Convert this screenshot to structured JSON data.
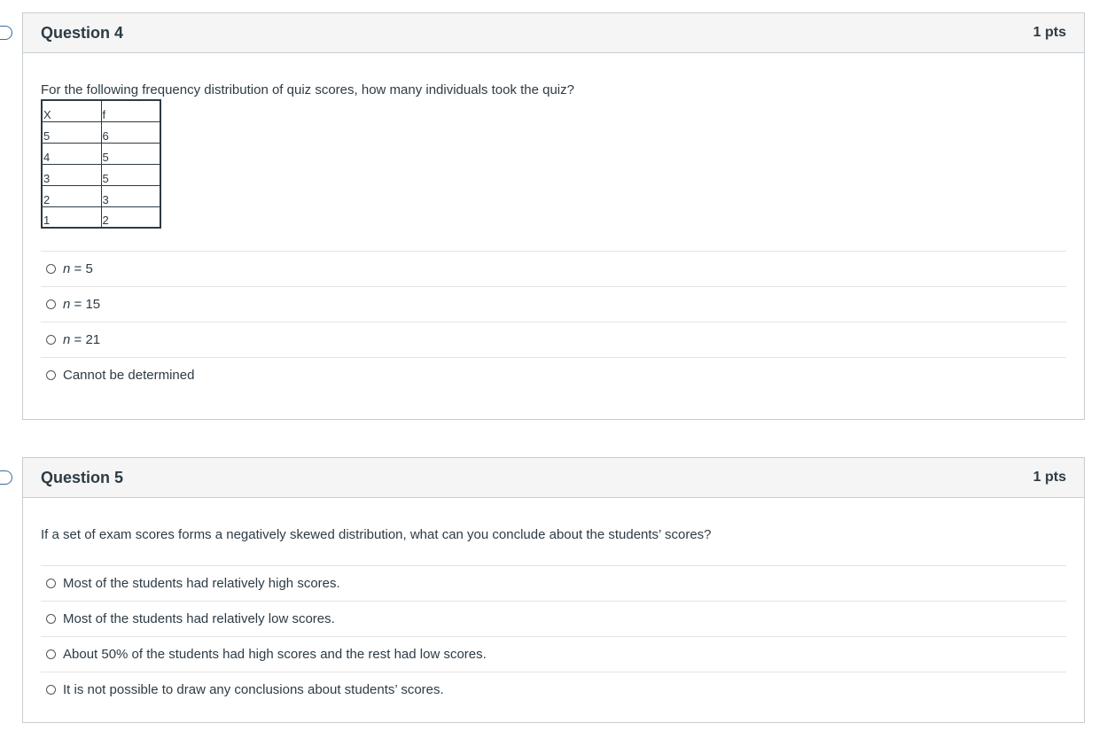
{
  "q4": {
    "title": "Question 4",
    "points": "1 pts",
    "prompt": "For the following frequency distribution of quiz scores, how many individuals took the quiz?",
    "table": {
      "headers": [
        "X",
        "f"
      ],
      "rows": [
        [
          "5",
          "6"
        ],
        [
          "4",
          "5"
        ],
        [
          "3",
          "5"
        ],
        [
          "2",
          "3"
        ],
        [
          "1",
          "2"
        ]
      ]
    },
    "answers": [
      {
        "var": "n",
        "rest": " = 5"
      },
      {
        "var": "n",
        "rest": " = 15"
      },
      {
        "var": "n",
        "rest": " = 21"
      },
      {
        "var": "",
        "rest": "Cannot be determined"
      }
    ]
  },
  "q5": {
    "title": "Question 5",
    "points": "1 pts",
    "prompt": "If a set of exam scores forms a negatively skewed distribution, what can you conclude about the students’ scores?",
    "answers": [
      "Most of the students had relatively high scores.",
      "Most of the students had relatively low scores.",
      "About 50% of the students had high scores and the rest had low scores.",
      "It is not possible to draw any conclusions about students’ scores."
    ]
  }
}
